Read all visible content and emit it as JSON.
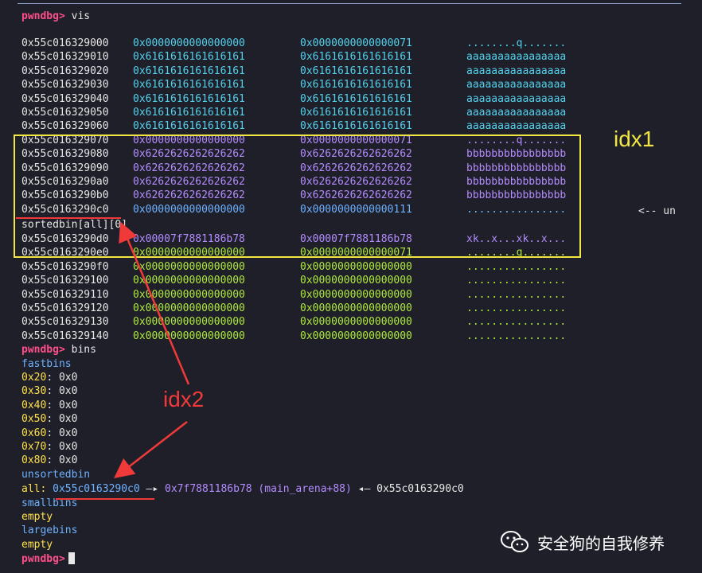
{
  "prompt": "pwndbg>",
  "cmd_vis": "vis",
  "cmd_bins": "bins",
  "heap_rows": [
    {
      "addr": "0x55c016329000",
      "c1": "0x0000000000000000",
      "c2": "0x0000000000000071",
      "asc": "........q.......",
      "color": "cyan"
    },
    {
      "addr": "0x55c016329010",
      "c1": "0x6161616161616161",
      "c2": "0x6161616161616161",
      "asc": "aaaaaaaaaaaaaaaa",
      "color": "cyan"
    },
    {
      "addr": "0x55c016329020",
      "c1": "0x6161616161616161",
      "c2": "0x6161616161616161",
      "asc": "aaaaaaaaaaaaaaaa",
      "color": "cyan"
    },
    {
      "addr": "0x55c016329030",
      "c1": "0x6161616161616161",
      "c2": "0x6161616161616161",
      "asc": "aaaaaaaaaaaaaaaa",
      "color": "cyan"
    },
    {
      "addr": "0x55c016329040",
      "c1": "0x6161616161616161",
      "c2": "0x6161616161616161",
      "asc": "aaaaaaaaaaaaaaaa",
      "color": "cyan"
    },
    {
      "addr": "0x55c016329050",
      "c1": "0x6161616161616161",
      "c2": "0x6161616161616161",
      "asc": "aaaaaaaaaaaaaaaa",
      "color": "cyan"
    },
    {
      "addr": "0x55c016329060",
      "c1": "0x6161616161616161",
      "c2": "0x6161616161616161",
      "asc": "aaaaaaaaaaaaaaaa",
      "color": "cyan"
    },
    {
      "addr": "0x55c016329070",
      "c1": "0x0000000000000000",
      "c2": "0x0000000000000071",
      "asc": "........q.......",
      "color": "purple"
    },
    {
      "addr": "0x55c016329080",
      "c1": "0x6262626262626262",
      "c2": "0x6262626262626262",
      "asc": "bbbbbbbbbbbbbbbb",
      "color": "purple"
    },
    {
      "addr": "0x55c016329090",
      "c1": "0x6262626262626262",
      "c2": "0x6262626262626262",
      "asc": "bbbbbbbbbbbbbbbb",
      "color": "purple"
    },
    {
      "addr": "0x55c0163290a0",
      "c1": "0x6262626262626262",
      "c2": "0x6262626262626262",
      "asc": "bbbbbbbbbbbbbbbb",
      "color": "purple"
    },
    {
      "addr": "0x55c0163290b0",
      "c1": "0x6262626262626262",
      "c2": "0x6262626262626262",
      "asc": "bbbbbbbbbbbbbbbb",
      "color": "purple"
    },
    {
      "addr": "0x55c0163290c0",
      "c1": "0x0000000000000000",
      "c2": "0x0000000000000111",
      "asc": "................",
      "color": "blue"
    }
  ],
  "sorted_label": "sortedbin[all][0]",
  "heap_rows2": [
    {
      "addr": "0x55c0163290d0",
      "c1": "0x00007f7881186b78",
      "c2": "0x00007f7881186b78",
      "asc": "xk..x...xk..x...",
      "color": "purple"
    },
    {
      "addr": "0x55c0163290e0",
      "c1": "0x0000000000000000",
      "c2": "0x0000000000000071",
      "asc": "........q.......",
      "color": "green"
    },
    {
      "addr": "0x55c0163290f0",
      "c1": "0x0000000000000000",
      "c2": "0x0000000000000000",
      "asc": "................",
      "color": "green"
    },
    {
      "addr": "0x55c016329100",
      "c1": "0x0000000000000000",
      "c2": "0x0000000000000000",
      "asc": "................",
      "color": "green"
    },
    {
      "addr": "0x55c016329110",
      "c1": "0x0000000000000000",
      "c2": "0x0000000000000000",
      "asc": "................",
      "color": "green"
    },
    {
      "addr": "0x55c016329120",
      "c1": "0x0000000000000000",
      "c2": "0x0000000000000000",
      "asc": "................",
      "color": "green"
    },
    {
      "addr": "0x55c016329130",
      "c1": "0x0000000000000000",
      "c2": "0x0000000000000000",
      "asc": "................",
      "color": "green"
    },
    {
      "addr": "0x55c016329140",
      "c1": "0x0000000000000000",
      "c2": "0x0000000000000000",
      "asc": "................",
      "color": "green"
    }
  ],
  "un_label": "<-- un",
  "bins": {
    "fastbins_label": "fastbins",
    "fast": [
      {
        "size": "0x20",
        "val": "0x0"
      },
      {
        "size": "0x30",
        "val": "0x0"
      },
      {
        "size": "0x40",
        "val": "0x0"
      },
      {
        "size": "0x50",
        "val": "0x0"
      },
      {
        "size": "0x60",
        "val": "0x0"
      },
      {
        "size": "0x70",
        "val": "0x0"
      },
      {
        "size": "0x80",
        "val": "0x0"
      }
    ],
    "unsorted_label": "unsortedbin",
    "all_key": "all:",
    "all_addr": "0x55c0163290c0",
    "arrow1": "—▸",
    "arena": "0x7f7881186b78 (main_arena+88)",
    "arrow2": "◂—",
    "back_addr": "0x55c0163290c0",
    "smallbins_label": "smallbins",
    "small_empty": "empty",
    "largebins_label": "largebins",
    "large_empty": "empty"
  },
  "annotations": {
    "idx1": "idx1",
    "idx2": "idx2"
  },
  "watermark": "安全狗的自我修养",
  "colors": {
    "cyan": "#54d1ec",
    "purple": "#b48cff",
    "green": "#b0ea3c",
    "blue": "#6fb2ff",
    "yellow_box": "#f2e742",
    "red": "#f03a3a",
    "prompt": "#ff4f8b"
  }
}
